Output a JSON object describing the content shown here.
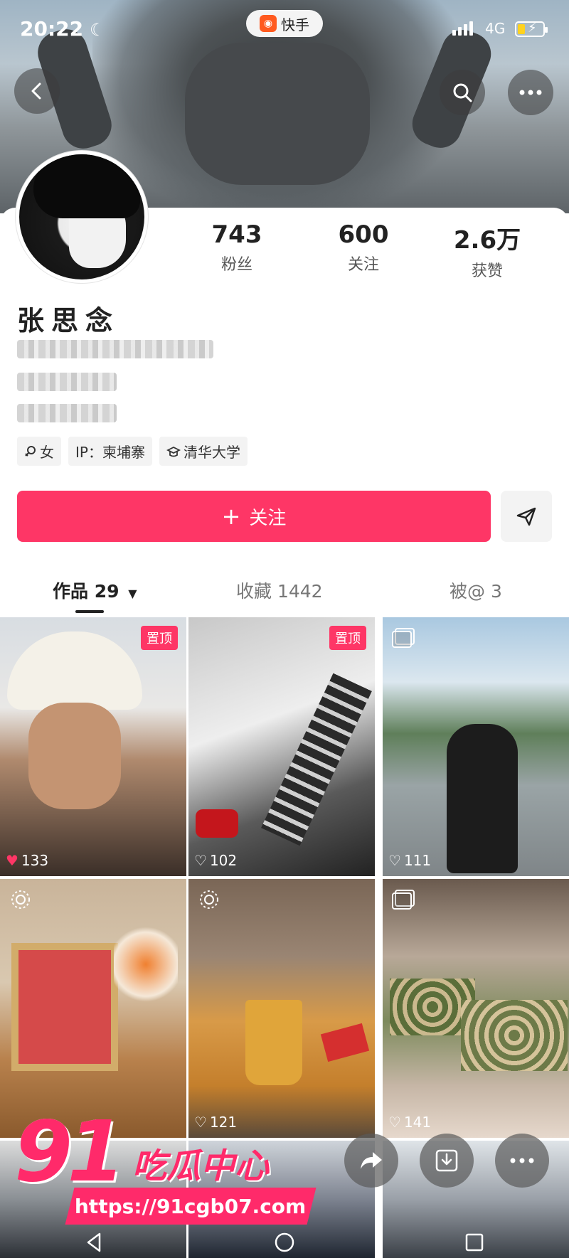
{
  "status": {
    "time": "20:22",
    "network": "4G",
    "app_name": "快手"
  },
  "profile": {
    "name": "张思念",
    "stats": [
      {
        "value": "743",
        "label": "粉丝"
      },
      {
        "value": "600",
        "label": "关注"
      },
      {
        "value": "2.6万",
        "label": "获赞"
      }
    ],
    "tags": [
      {
        "icon": "gender-icon",
        "text": "女"
      },
      {
        "icon": "",
        "text": "IP：柬埔寨"
      },
      {
        "icon": "school-icon",
        "text": "清华大学"
      }
    ],
    "follow_label": "关注"
  },
  "tabs": [
    {
      "label": "作品 29"
    },
    {
      "label": "收藏 1442"
    },
    {
      "label": "被@ 3"
    }
  ],
  "grid": [
    {
      "likes": "133",
      "pinned": "置顶",
      "liked": true
    },
    {
      "likes": "102",
      "pinned": "置顶",
      "liked": false
    },
    {
      "likes": "111",
      "pinned": "",
      "liked": false
    },
    {
      "likes": "",
      "pinned": "",
      "liked": false
    },
    {
      "likes": "121",
      "pinned": "",
      "liked": false
    },
    {
      "likes": "141",
      "pinned": "",
      "liked": false
    }
  ],
  "watermark": {
    "number": "91",
    "brand": "吃瓜中心",
    "url": "https://91cgb07.com"
  },
  "colors": {
    "accent": "#fe3666",
    "watermark": "#ff2a6a"
  }
}
